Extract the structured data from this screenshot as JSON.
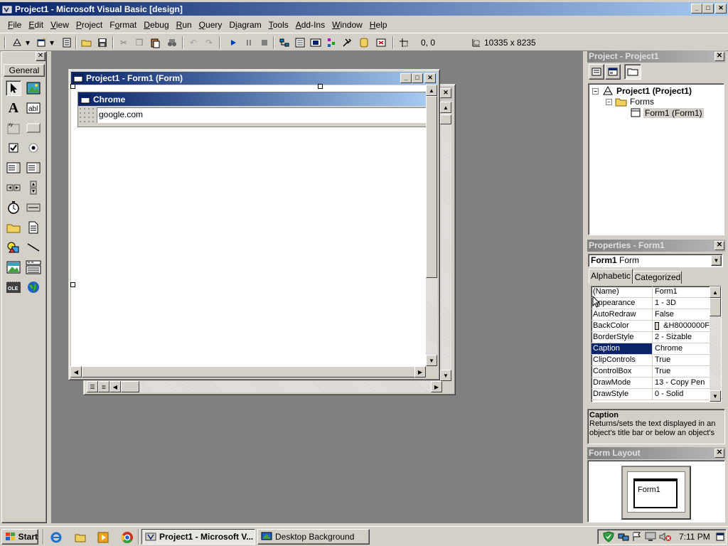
{
  "window": {
    "title": "Project1 - Microsoft Visual Basic [design]"
  },
  "menu": [
    {
      "label": "File",
      "key": "F"
    },
    {
      "label": "Edit",
      "key": "E"
    },
    {
      "label": "View",
      "key": "V"
    },
    {
      "label": "Project",
      "key": "P"
    },
    {
      "label": "Format",
      "key": "o"
    },
    {
      "label": "Debug",
      "key": "D"
    },
    {
      "label": "Run",
      "key": "R"
    },
    {
      "label": "Query",
      "key": "Q"
    },
    {
      "label": "Diagram",
      "key": "i"
    },
    {
      "label": "Tools",
      "key": "T"
    },
    {
      "label": "Add-Ins",
      "key": "A"
    },
    {
      "label": "Window",
      "key": "W"
    },
    {
      "label": "Help",
      "key": "H"
    }
  ],
  "toolbar": {
    "position": "0, 0",
    "size": "10335 x 8235"
  },
  "toolbox": {
    "tab_label": "General"
  },
  "form_designer": {
    "title": "Project1 - Form1 (Form)",
    "form_caption": "Chrome",
    "textbox_value": "google.com"
  },
  "project_explorer": {
    "title": "Project - Project1",
    "root": "Project1 (Project1)",
    "folder": "Forms",
    "item": "Form1 (Form1)"
  },
  "properties": {
    "title": "Properties - Form1",
    "object_name": "Form1",
    "object_type": "Form",
    "tab_alphabetic": "Alphabetic",
    "tab_categorized": "Categorized",
    "rows": [
      {
        "name": "(Name)",
        "value": "Form1"
      },
      {
        "name": "Appearance",
        "value": "1 - 3D"
      },
      {
        "name": "AutoRedraw",
        "value": "False"
      },
      {
        "name": "BackColor",
        "value": "&H8000000F"
      },
      {
        "name": "BorderStyle",
        "value": "2 - Sizable"
      },
      {
        "name": "Caption",
        "value": "Chrome"
      },
      {
        "name": "ClipControls",
        "value": "True"
      },
      {
        "name": "ControlBox",
        "value": "True"
      },
      {
        "name": "DrawMode",
        "value": "13 - Copy Pen"
      },
      {
        "name": "DrawStyle",
        "value": "0 - Solid"
      }
    ],
    "selected_index": 5,
    "description_title": "Caption",
    "description_text": "Returns/sets the text displayed in an object's title bar or below an object's"
  },
  "form_layout": {
    "title": "Form Layout",
    "form_label": "Form1"
  },
  "taskbar": {
    "start_label": "Start",
    "tasks": [
      "Project1 - Microsoft V...",
      "Desktop Background"
    ],
    "clock": "7:11 PM"
  }
}
